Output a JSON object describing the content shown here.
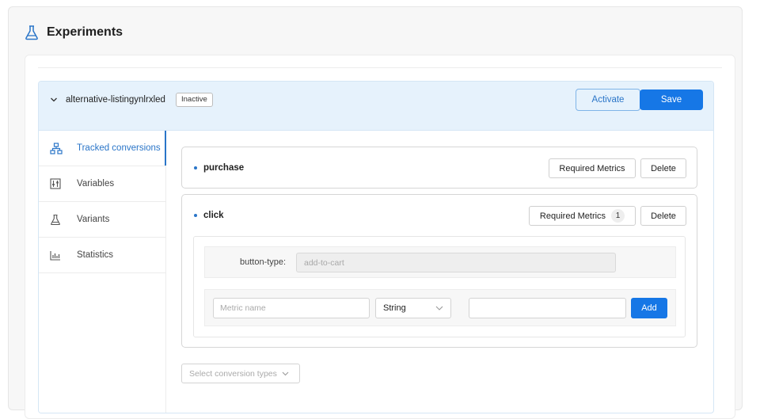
{
  "header": {
    "title": "Experiments",
    "icon": "flask-icon"
  },
  "experiment": {
    "name": "alternative-listingynlrxled",
    "status": "Inactive",
    "actions": {
      "activate_label": "Activate",
      "save_label": "Save"
    }
  },
  "sidebar": {
    "items": [
      {
        "label": "Tracked conversions",
        "icon": "sitemap-icon",
        "active": true
      },
      {
        "label": "Variables",
        "icon": "sliders-icon",
        "active": false
      },
      {
        "label": "Variants",
        "icon": "flask-icon",
        "active": false
      },
      {
        "label": "Statistics",
        "icon": "bar-chart-icon",
        "active": false
      }
    ]
  },
  "conversions": [
    {
      "name": "purchase",
      "required_metrics_label": "Required Metrics",
      "delete_label": "Delete"
    },
    {
      "name": "click",
      "required_metrics_label": "Required Metrics",
      "required_metrics_count": "1",
      "delete_label": "Delete",
      "metrics": [
        {
          "name": "button-type:",
          "value": "add-to-cart"
        }
      ],
      "new_metric": {
        "name_placeholder": "Metric name",
        "type": "String",
        "value": "",
        "add_label": "Add"
      }
    }
  ],
  "conversion_type_select": {
    "placeholder": "Select conversion types"
  },
  "colors": {
    "accent": "#1677e6",
    "accent_text": "#2a75c8",
    "header_bg": "#e6f2fc"
  }
}
